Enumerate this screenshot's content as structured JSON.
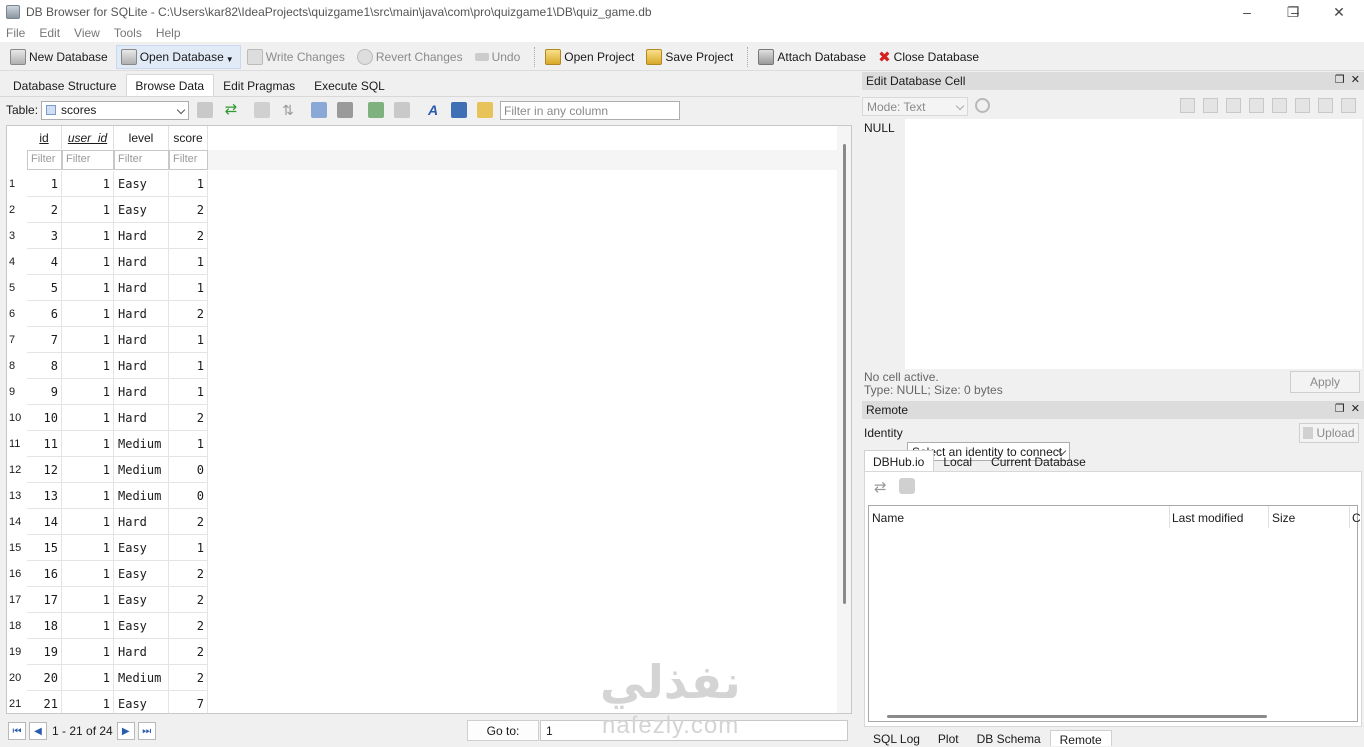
{
  "window": {
    "title": "DB Browser for SQLite - C:\\Users\\kar82\\IdeaProjects\\quizgame1\\src\\main\\java\\com\\pro\\quizgame1\\DB\\quiz_game.db",
    "controls": [
      "–",
      "❐",
      "✕"
    ]
  },
  "menu": [
    "File",
    "Edit",
    "View",
    "Tools",
    "Help"
  ],
  "toolbar": {
    "new_db": "New Database",
    "open_db": "Open Database",
    "write": "Write Changes",
    "revert": "Revert Changes",
    "undo": "Undo",
    "open_project": "Open Project",
    "save_project": "Save Project",
    "attach": "Attach Database",
    "close": "Close Database"
  },
  "tabs": [
    "Database Structure",
    "Browse Data",
    "Edit Pragmas",
    "Execute SQL"
  ],
  "browse": {
    "table_label": "Table:",
    "table_value": "scores",
    "filter_placeholder": "Filter in any column",
    "columns": [
      "id",
      "user_id",
      "level",
      "score"
    ],
    "filter_text": "Filter",
    "rows": [
      [
        "1",
        "1",
        "Easy",
        "1"
      ],
      [
        "2",
        "1",
        "Easy",
        "2"
      ],
      [
        "3",
        "1",
        "Hard",
        "2"
      ],
      [
        "4",
        "1",
        "Hard",
        "1"
      ],
      [
        "5",
        "1",
        "Hard",
        "1"
      ],
      [
        "6",
        "1",
        "Hard",
        "2"
      ],
      [
        "7",
        "1",
        "Hard",
        "1"
      ],
      [
        "8",
        "1",
        "Hard",
        "1"
      ],
      [
        "9",
        "1",
        "Hard",
        "1"
      ],
      [
        "10",
        "1",
        "Hard",
        "2"
      ],
      [
        "11",
        "1",
        "Medium",
        "1"
      ],
      [
        "12",
        "1",
        "Medium",
        "0"
      ],
      [
        "13",
        "1",
        "Medium",
        "0"
      ],
      [
        "14",
        "1",
        "Hard",
        "2"
      ],
      [
        "15",
        "1",
        "Easy",
        "1"
      ],
      [
        "16",
        "1",
        "Easy",
        "2"
      ],
      [
        "17",
        "1",
        "Easy",
        "2"
      ],
      [
        "18",
        "1",
        "Easy",
        "2"
      ],
      [
        "19",
        "1",
        "Hard",
        "2"
      ],
      [
        "20",
        "1",
        "Medium",
        "2"
      ],
      [
        "21",
        "1",
        "Easy",
        "7"
      ]
    ],
    "record_info": "1 - 21 of 24",
    "goto_label": "Go to:",
    "goto_value": "1"
  },
  "edit_cell": {
    "title": "Edit Database Cell",
    "mode_label": "Mode: Text",
    "null_text": "NULL",
    "status1": "No cell active.",
    "status2": "Type: NULL; Size: 0 bytes",
    "apply": "Apply"
  },
  "remote": {
    "title": "Remote",
    "identity_label": "Identity",
    "identity_value": "Select an identity to connect",
    "upload": "Upload",
    "tabs": [
      "DBHub.io",
      "Local",
      "Current Database"
    ],
    "columns": [
      "Name",
      "Last modified",
      "Size",
      "C"
    ]
  },
  "bottom_tabs": [
    "SQL Log",
    "Plot",
    "DB Schema",
    "Remote"
  ],
  "watermark": {
    "arabic": "نفذلي",
    "latin": "nafezly.com"
  }
}
